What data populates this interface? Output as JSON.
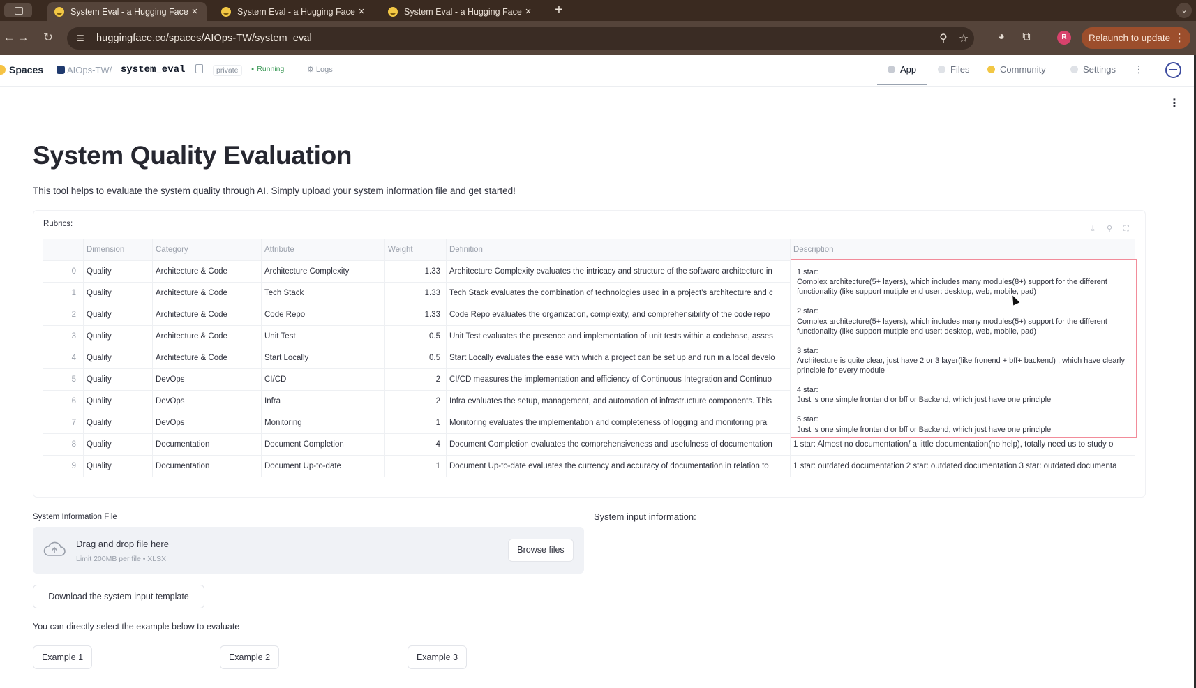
{
  "browser": {
    "tabs": [
      {
        "title": "System Eval - a Hugging Face"
      },
      {
        "title": "System Eval - a Hugging Face"
      },
      {
        "title": "System Eval - a Hugging Face"
      }
    ],
    "url": "huggingface.co/spaces/AIOps-TW/system_eval",
    "relaunch_label": "Relaunch to update",
    "profile_initial": "R"
  },
  "space_header": {
    "spaces_label": "Spaces",
    "org": "AIOps-TW",
    "separator": "/",
    "space_name": "system_eval",
    "visibility": "private",
    "status": "Running",
    "logs_label": "Logs",
    "nav": {
      "app": "App",
      "files": "Files",
      "community": "Community",
      "settings": "Settings"
    }
  },
  "page": {
    "title": "System Quality Evaluation",
    "description": "This tool helps to evaluate the system quality through AI. Simply upload your system information file and get started!"
  },
  "rubrics": {
    "label": "Rubrics:",
    "columns": [
      "",
      "Dimension",
      "Category",
      "Attribute",
      "Weight",
      "Definition",
      "Description"
    ],
    "rows": [
      {
        "idx": "0",
        "dimension": "Quality",
        "category": "Architecture & Code",
        "attribute": "Architecture Complexity",
        "weight": "1.33",
        "definition": "Architecture Complexity evaluates the intricacy and structure of the software architecture in",
        "description": ""
      },
      {
        "idx": "1",
        "dimension": "Quality",
        "category": "Architecture & Code",
        "attribute": "Tech Stack",
        "weight": "1.33",
        "definition": "Tech Stack evaluates the combination of technologies used in a project's architecture and c",
        "description": ""
      },
      {
        "idx": "2",
        "dimension": "Quality",
        "category": "Architecture & Code",
        "attribute": "Code Repo",
        "weight": "1.33",
        "definition": "Code Repo evaluates the organization, complexity, and comprehensibility of the code repo",
        "description": ""
      },
      {
        "idx": "3",
        "dimension": "Quality",
        "category": "Architecture & Code",
        "attribute": "Unit Test",
        "weight": "0.5",
        "definition": "Unit Test evaluates the presence and implementation of unit tests within a codebase, asses",
        "description": ""
      },
      {
        "idx": "4",
        "dimension": "Quality",
        "category": "Architecture & Code",
        "attribute": "Start Locally",
        "weight": "0.5",
        "definition": "Start Locally evaluates the ease with which a project can be set up and run in a local develo",
        "description": ""
      },
      {
        "idx": "5",
        "dimension": "Quality",
        "category": "DevOps",
        "attribute": "CI/CD",
        "weight": "2",
        "definition": "CI/CD measures the implementation and efficiency of Continuous Integration and Continuo",
        "description": ""
      },
      {
        "idx": "6",
        "dimension": "Quality",
        "category": "DevOps",
        "attribute": "Infra",
        "weight": "2",
        "definition": "Infra evaluates the setup, management, and automation of infrastructure components. This",
        "description": ""
      },
      {
        "idx": "7",
        "dimension": "Quality",
        "category": "DevOps",
        "attribute": "Monitoring",
        "weight": "1",
        "definition": "Monitoring evaluates the implementation and completeness of logging and monitoring pra",
        "description": ""
      },
      {
        "idx": "8",
        "dimension": "Quality",
        "category": "Documentation",
        "attribute": "Document Completion",
        "weight": "4",
        "definition": "Document Completion evaluates the comprehensiveness and usefulness of documentation",
        "description": "1 star: Almost no documentation/ a little documentation(no help), totally need us to study o"
      },
      {
        "idx": "9",
        "dimension": "Quality",
        "category": "Documentation",
        "attribute": "Document Up-to-date",
        "weight": "1",
        "definition": "Document Up-to-date evaluates the currency and accuracy of documentation in relation to",
        "description": "1 star: outdated documentation 2 star: outdated documentation 3 star: outdated documenta"
      }
    ],
    "expanded_description": [
      {
        "star": "1 star:",
        "text": "Complex architecture(5+ layers), which includes many modules(8+) support for the different functionality   (like support mutiple end user: desktop, web, mobile, pad)"
      },
      {
        "star": "2 star:",
        "text": "Complex architecture(5+ layers), which includes many modules(5+) support for the different functionality   (like support mutiple end user: desktop, web, mobile, pad)"
      },
      {
        "star": "3 star:",
        "text": "Architecture is quite clear, just have 2 or 3 layer(like fronend + bff+ backend) , which have clearly principle for every module"
      },
      {
        "star": "4 star:",
        "text": "Just is one simple frontend or bff or Backend, which just have one principle"
      },
      {
        "star": "5 star:",
        "text": "Just is one simple frontend or bff or Backend, which just have one principle"
      }
    ]
  },
  "uploader": {
    "label": "System Information File",
    "drop_title": "Drag and drop file here",
    "limit": "Limit 200MB per file • XLSX",
    "browse_label": "Browse files"
  },
  "system_input_label": "System input information:",
  "template_button": "Download the system input template",
  "example_prompt": "You can directly select the example below to evaluate",
  "examples": [
    "Example 1",
    "Example 2",
    "Example 3"
  ]
}
